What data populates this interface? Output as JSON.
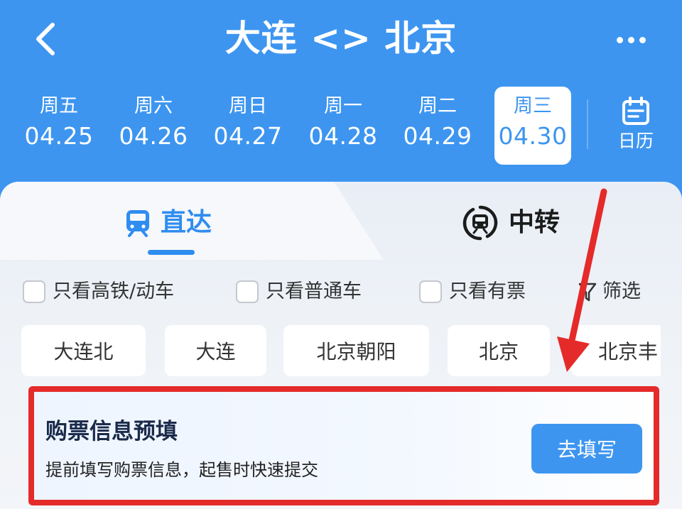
{
  "header": {
    "title": "大连 <> 北京",
    "back_icon": "chevron-left-icon",
    "more_icon": "more-dots-icon"
  },
  "dates": [
    {
      "weekday": "周五",
      "date": "04.25",
      "selected": false
    },
    {
      "weekday": "周六",
      "date": "04.26",
      "selected": false
    },
    {
      "weekday": "周日",
      "date": "04.27",
      "selected": false
    },
    {
      "weekday": "周一",
      "date": "04.28",
      "selected": false
    },
    {
      "weekday": "周二",
      "date": "04.29",
      "selected": false
    },
    {
      "weekday": "周三",
      "date": "04.30",
      "selected": true
    }
  ],
  "calendar": {
    "label": "日历",
    "icon": "calendar-icon"
  },
  "tabs": {
    "direct": {
      "label": "直达",
      "icon": "train-icon",
      "active": true
    },
    "transfer": {
      "label": "中转",
      "icon": "transfer-train-icon",
      "active": false
    }
  },
  "filters": [
    {
      "label": "只看高铁/动车",
      "checked": false
    },
    {
      "label": "只看普通车",
      "checked": false
    },
    {
      "label": "只看有票",
      "checked": false
    }
  ],
  "screen": {
    "label": "筛选"
  },
  "stations": [
    "大连北",
    "大连",
    "北京朝阳",
    "北京",
    "北京丰"
  ],
  "prefill": {
    "title": "购票信息预填",
    "description": "提前填写购票信息，起售时快速提交",
    "button_label": "去填写"
  },
  "colors": {
    "primary": "#3d95f0",
    "accent_blue": "#2f8df0",
    "annotation_red": "#e52a2a"
  }
}
